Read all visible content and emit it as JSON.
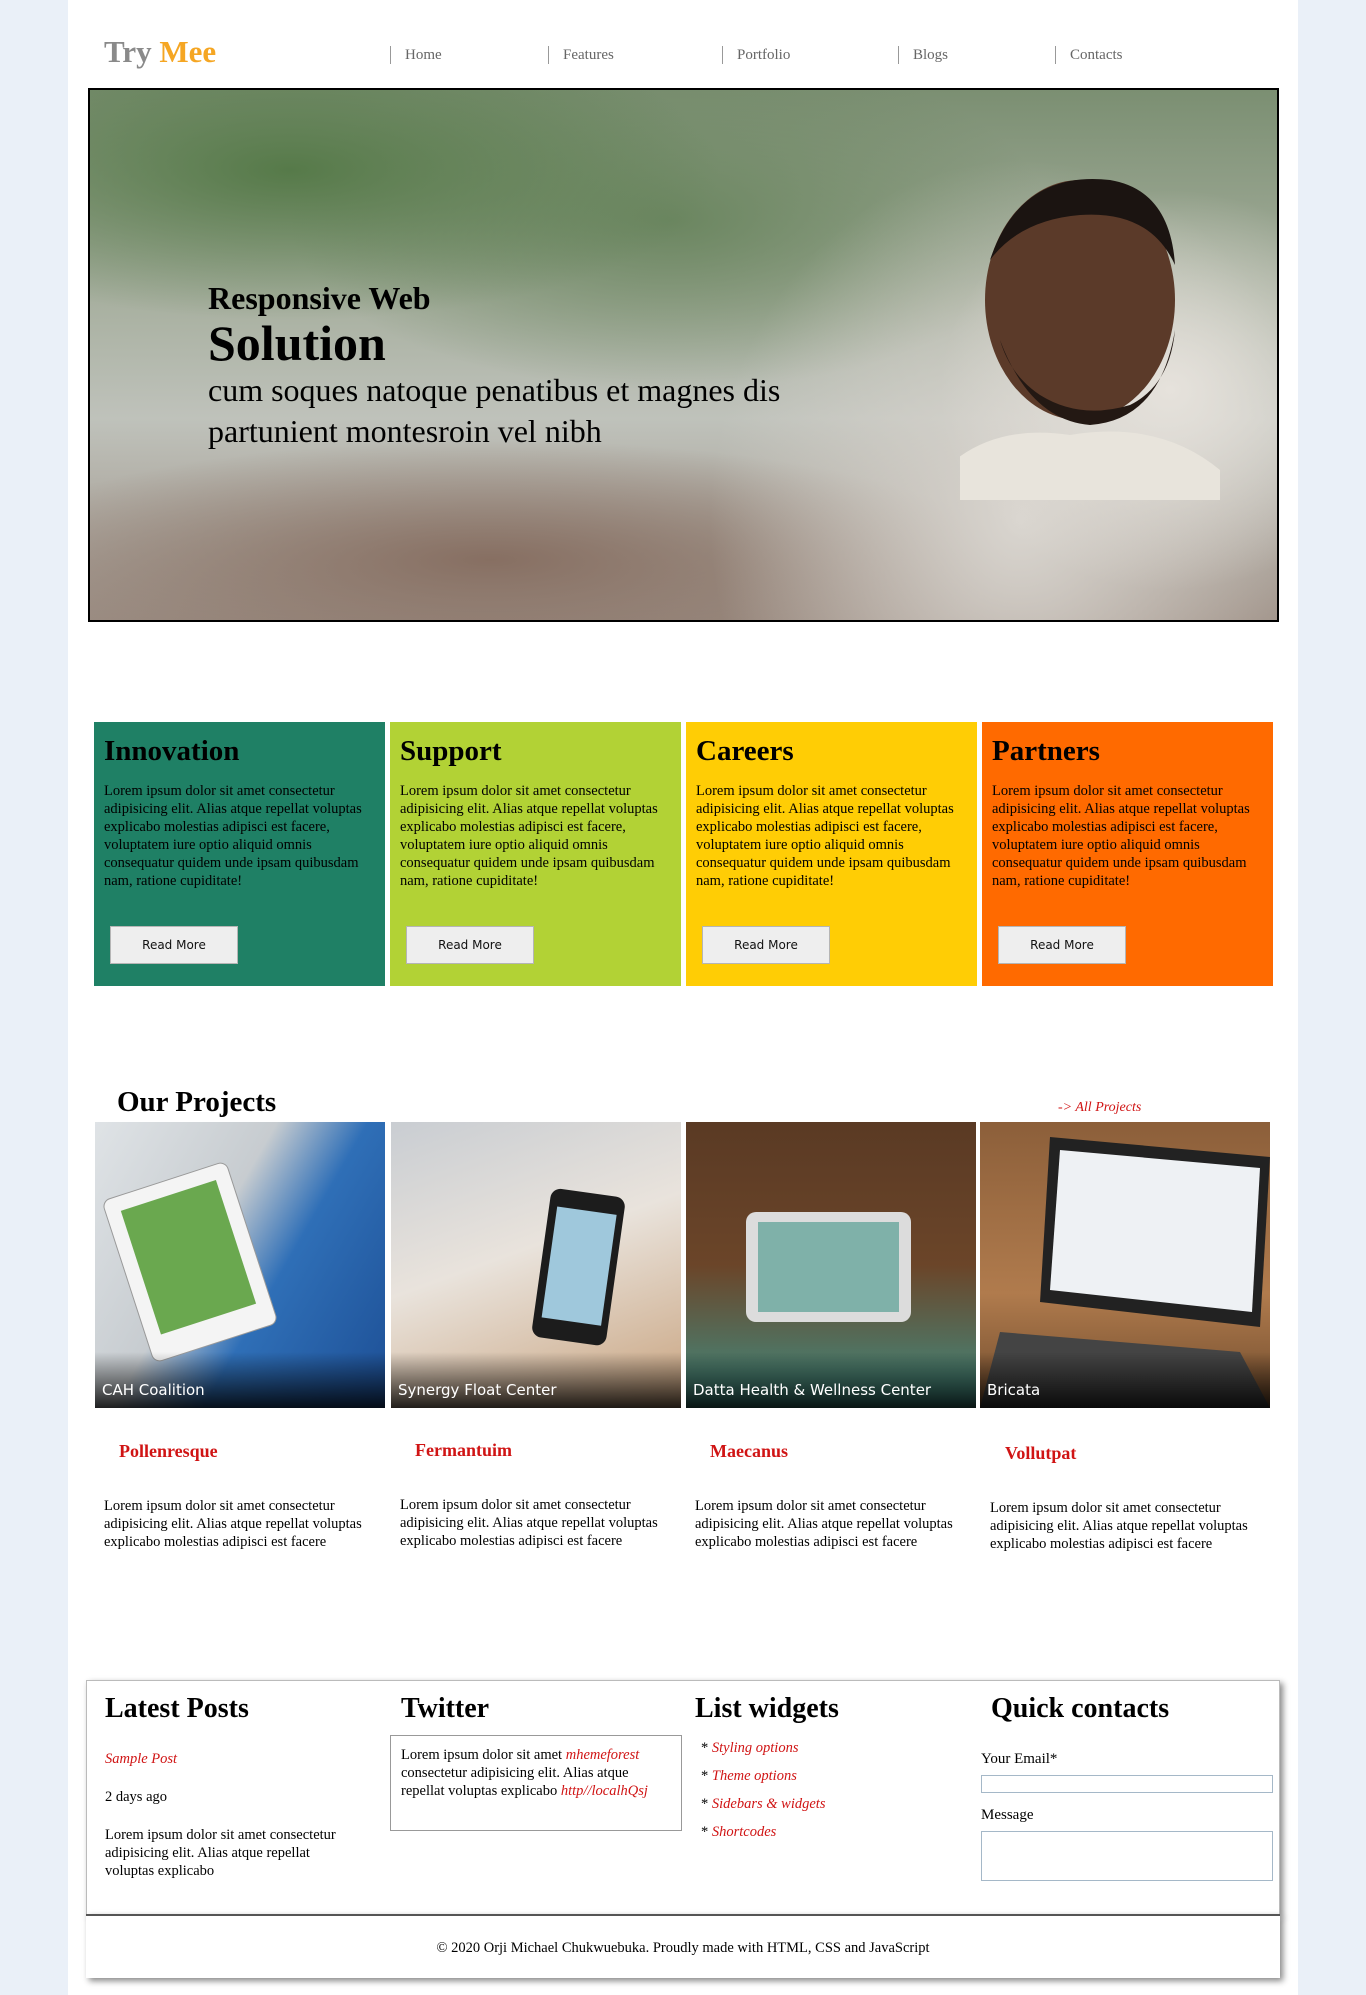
{
  "brand": {
    "part1": "Try",
    "part2": "Mee"
  },
  "nav": [
    "Home",
    "Features",
    "Portfolio",
    "Blogs",
    "Contacts"
  ],
  "hero": {
    "line1": "Responsive Web",
    "line2": "Solution",
    "line3": "cum soques natoque penatibus et magnes dis partunient montesroin vel nibh"
  },
  "features": [
    {
      "title": "Innovation",
      "text": "Lorem ipsum dolor sit amet consectetur adipisicing elit. Alias atque repellat voluptas explicabo molestias adipisci est facere, voluptatem iure optio aliquid omnis consequatur quidem unde ipsam quibusdam nam, ratione cupiditate!",
      "button": "Read More",
      "color": "#1f8065"
    },
    {
      "title": "Support",
      "text": "Lorem ipsum dolor sit amet consectetur adipisicing elit. Alias atque repellat voluptas explicabo molestias adipisci est facere, voluptatem iure optio aliquid omnis consequatur quidem unde ipsam quibusdam nam, ratione cupiditate!",
      "button": "Read More",
      "color": "#b2d235"
    },
    {
      "title": "Careers",
      "text": "Lorem ipsum dolor sit amet consectetur adipisicing elit. Alias atque repellat voluptas explicabo molestias adipisci est facere, voluptatem iure optio aliquid omnis consequatur quidem unde ipsam quibusdam nam, ratione cupiditate!",
      "button": "Read More",
      "color": "#ffcd05"
    },
    {
      "title": "Partners",
      "text": "Lorem ipsum dolor sit amet consectetur adipisicing elit. Alias atque repellat voluptas explicabo molestias adipisci est facere, voluptatem iure optio aliquid omnis consequatur quidem unde ipsam quibusdam nam, ratione cupiditate!",
      "button": "Read More",
      "color": "#ff6a00"
    }
  ],
  "projects": {
    "title": "Our Projects",
    "all_link": "-> All Projects",
    "items": [
      {
        "caption": "CAH Coalition",
        "name": "Pollenresque",
        "text": "Lorem ipsum dolor sit amet consectetur adipisicing elit. Alias atque repellat voluptas explicabo molestias adipisci est facere"
      },
      {
        "caption": "Synergy Float Center",
        "name": "Fermantuim",
        "text": "Lorem ipsum dolor sit amet consectetur adipisicing elit. Alias atque repellat voluptas explicabo molestias adipisci est facere"
      },
      {
        "caption": "Datta Health & Wellness Center",
        "name": "Maecanus",
        "text": "Lorem ipsum dolor sit amet consectetur adipisicing elit. Alias atque repellat voluptas explicabo molestias adipisci est facere"
      },
      {
        "caption": "Bricata",
        "name": "Vollutpat",
        "text": "Lorem ipsum dolor sit amet consectetur adipisicing elit. Alias atque repellat voluptas explicabo molestias adipisci est facere"
      }
    ]
  },
  "widgets": {
    "latest": {
      "title": "Latest Posts",
      "post": "Sample Post",
      "date": "2 days ago",
      "text": "Lorem ipsum dolor sit amet consectetur adipisicing elit. Alias atque repellat voluptas explicabo"
    },
    "twitter": {
      "title": "Twitter",
      "pre": "Lorem ipsum dolor sit amet ",
      "handle": "mhemeforest",
      "mid": " consectetur adipisicing elit. Alias atque repellat voluptas explicabo ",
      "link": "http//localhQsj"
    },
    "list": {
      "title": "List widgets",
      "items": [
        "Styling options",
        "Theme options",
        "Sidebars & widgets",
        "Shortcodes"
      ]
    },
    "contacts": {
      "title": "Quick contacts",
      "email_label": "Your Email*",
      "message_label": "Message"
    }
  },
  "footer": "© 2020 Orji Michael Chukwuebuka. Proudly made with HTML, CSS and JavaScript"
}
